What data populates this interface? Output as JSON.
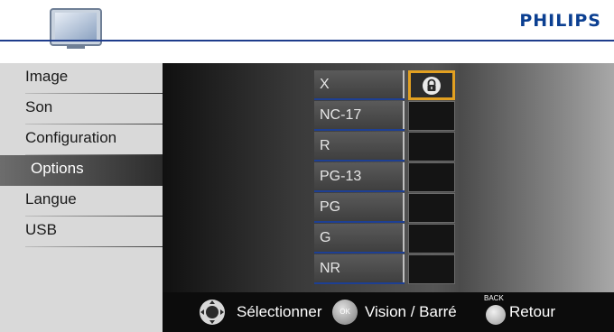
{
  "header": {
    "brand": "PHILIPS",
    "tv_icon": "tv-icon"
  },
  "sidebar": {
    "items": [
      {
        "label": "Image",
        "selected": false
      },
      {
        "label": "Son",
        "selected": false
      },
      {
        "label": "Configuration",
        "selected": false
      },
      {
        "label": "Options",
        "selected": true
      },
      {
        "label": "Langue",
        "selected": false
      },
      {
        "label": "USB",
        "selected": false
      }
    ]
  },
  "ratings": {
    "items": [
      {
        "label": "X",
        "locked": true,
        "focused": true
      },
      {
        "label": "NC-17",
        "locked": false,
        "focused": false
      },
      {
        "label": "R",
        "locked": false,
        "focused": false
      },
      {
        "label": "PG-13",
        "locked": false,
        "focused": false
      },
      {
        "label": "PG",
        "locked": false,
        "focused": false
      },
      {
        "label": "G",
        "locked": false,
        "focused": false
      },
      {
        "label": "NR",
        "locked": false,
        "focused": false
      }
    ],
    "lock_icon": "lock-icon"
  },
  "footer": {
    "select_label": "Sélectionner",
    "select_icon": "dpad-icon",
    "ok_caption": "OK",
    "view_label": "Vision / Barré",
    "back_caption": "BACK",
    "back_label": "Retour"
  },
  "colors": {
    "accent": "#e2a021",
    "brand": "#0b3f91",
    "divider": "#1d3f94"
  }
}
